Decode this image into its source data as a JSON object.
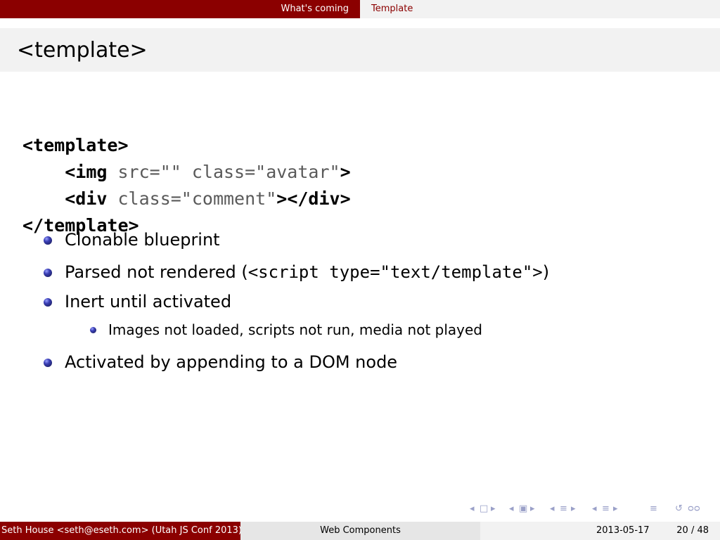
{
  "nav": {
    "sections": [
      "What's coming",
      "Template"
    ]
  },
  "frame": {
    "title": "<template>"
  },
  "code": {
    "lines": [
      [
        "",
        "<template>",
        "",
        ">"
      ],
      [
        "    ",
        "<img",
        " src=\"\" class=\"avatar\"",
        ">"
      ],
      [
        "    ",
        "<div",
        " class=\"comment\"",
        "></div>"
      ],
      [
        "",
        "</template>",
        "",
        ""
      ]
    ]
  },
  "bullets": [
    {
      "level": 1,
      "text": "Clonable blueprint"
    },
    {
      "level": 1,
      "text": "Parsed not rendered (",
      "code": "<script type=\"text/template\">",
      "after": ")"
    },
    {
      "level": 1,
      "text": "Inert until activated"
    },
    {
      "level": 2,
      "text": "Images not loaded, scripts not run, media not played"
    },
    {
      "level": 1,
      "text": "Activated by appending to a DOM node"
    }
  ],
  "footer": {
    "author": "Seth House <seth@eseth.com>  (Utah JS Conf 2013)",
    "title": "Web Components",
    "date": "2013-05-17",
    "page": "20 / 48"
  },
  "colors": {
    "accent": "#8b0000",
    "band_light": "#f2f2f2",
    "band_mid": "#e6e6e6",
    "bullet": "#2a2e8a"
  },
  "nav_symbols": [
    "frame-prev-icon",
    "frame-icon",
    "frame-next-icon",
    "subsection-prev-icon",
    "subsection-icon",
    "subsection-next-icon",
    "section-prev-icon",
    "section-icon",
    "section-next-icon",
    "section-prev2-icon",
    "outline-icon",
    "section-next2-icon",
    "align-icon",
    "back-icon",
    "search-icon"
  ]
}
